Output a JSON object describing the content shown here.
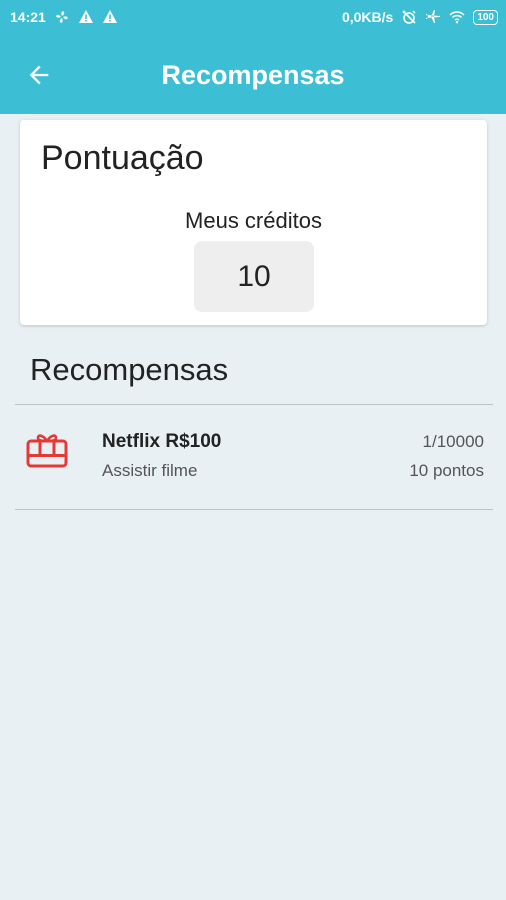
{
  "status_bar": {
    "time": "14:21",
    "network_speed": "0,0KB/s",
    "battery": "100",
    "left_icons": [
      "fan-icon",
      "warning-icon",
      "warning-icon"
    ],
    "right_icons": [
      "alarm-off-icon",
      "airplane-icon",
      "wifi-icon",
      "battery-icon"
    ]
  },
  "app_bar": {
    "title": "Recompensas",
    "back_icon": "arrow-back-icon",
    "color": "#3cbfd5"
  },
  "score_card": {
    "title": "Pontuação",
    "credits_label": "Meus créditos",
    "credits_value": "10"
  },
  "rewards_section": {
    "title": "Recompensas",
    "items": [
      {
        "icon": "gift-card-icon",
        "icon_color": "#e53935",
        "name": "Netflix R$100",
        "description": "Assistir filme",
        "progress": "1/10000",
        "points": "10 pontos"
      }
    ]
  }
}
